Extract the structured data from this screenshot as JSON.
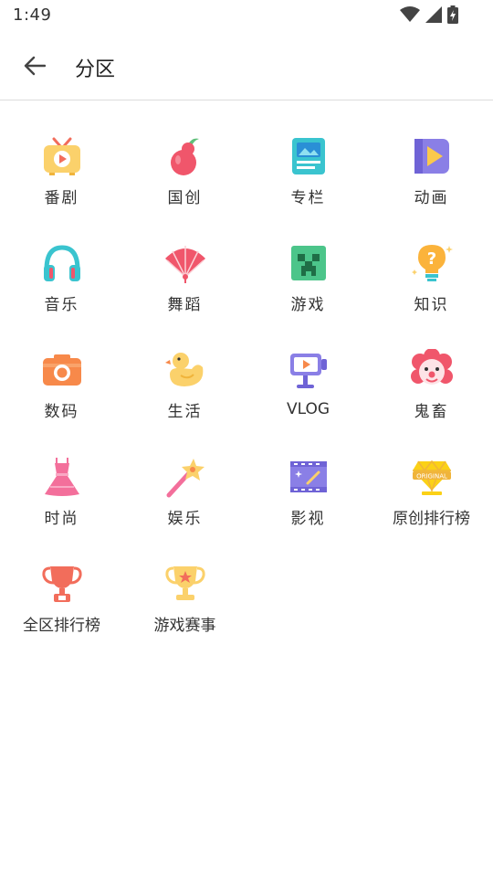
{
  "status_bar": {
    "time": "1:49"
  },
  "header": {
    "title": "分区"
  },
  "categories": [
    {
      "label": "番剧",
      "icon": "tv-icon"
    },
    {
      "label": "国创",
      "icon": "gourd-icon"
    },
    {
      "label": "专栏",
      "icon": "article-icon"
    },
    {
      "label": "动画",
      "icon": "animation-icon"
    },
    {
      "label": "音乐",
      "icon": "headphones-icon"
    },
    {
      "label": "舞蹈",
      "icon": "fan-icon"
    },
    {
      "label": "游戏",
      "icon": "creeper-icon"
    },
    {
      "label": "知识",
      "icon": "lightbulb-icon"
    },
    {
      "label": "数码",
      "icon": "camera-icon"
    },
    {
      "label": "生活",
      "icon": "duck-icon"
    },
    {
      "label": "VLOG",
      "icon": "vlog-camera-icon"
    },
    {
      "label": "鬼畜",
      "icon": "clown-icon"
    },
    {
      "label": "时尚",
      "icon": "dress-icon"
    },
    {
      "label": "娱乐",
      "icon": "magic-wand-icon"
    },
    {
      "label": "影视",
      "icon": "film-icon"
    },
    {
      "label": "原创排行榜",
      "icon": "original-badge-icon"
    },
    {
      "label": "全区排行榜",
      "icon": "trophy-red-icon"
    },
    {
      "label": "游戏赛事",
      "icon": "trophy-gold-icon"
    }
  ],
  "colors": {
    "divider": "#dcdcdc",
    "text": "#333333"
  }
}
